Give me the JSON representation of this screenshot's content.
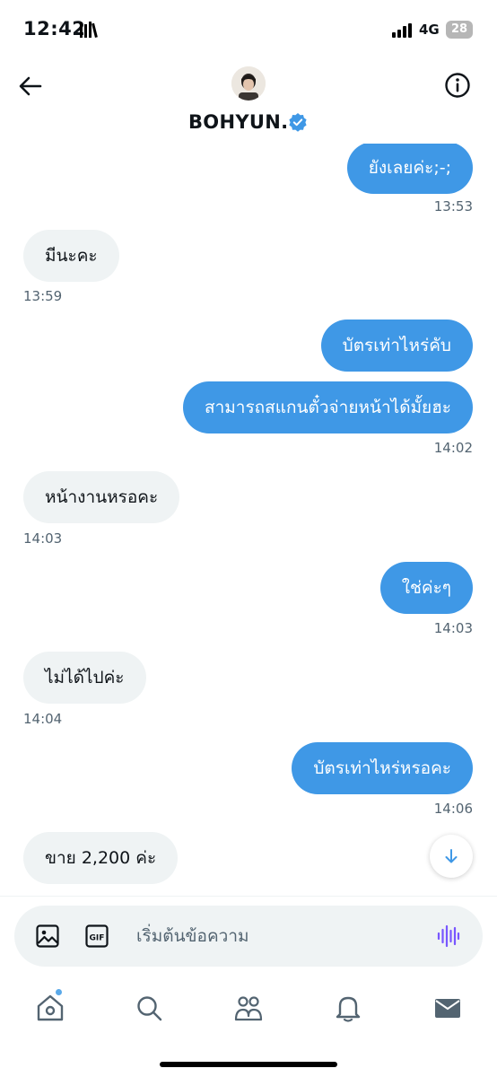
{
  "status_bar": {
    "time": "12:42",
    "network": "4G",
    "battery": "28"
  },
  "header": {
    "contact_name": "BOHYUN."
  },
  "messages": [
    {
      "direction": "out",
      "text": "ยังเลยค่ะ;-;"
    },
    {
      "direction": "out",
      "time": "13:53"
    },
    {
      "direction": "in",
      "text": "มีนะคะ"
    },
    {
      "direction": "in",
      "time": "13:59"
    },
    {
      "direction": "out",
      "text": "บัตรเท่าไหร่คับ"
    },
    {
      "direction": "out",
      "text": "สามารถสแกนตั๋วจ่ายหน้าได้มั้ยฮะ"
    },
    {
      "direction": "out",
      "time": "14:02"
    },
    {
      "direction": "in",
      "text": "หน้างานหรอคะ"
    },
    {
      "direction": "in",
      "time": "14:03"
    },
    {
      "direction": "out",
      "text": "ใช่ค่ะๆ"
    },
    {
      "direction": "out",
      "time": "14:03"
    },
    {
      "direction": "in",
      "text": "ไม่ได้ไปค่ะ"
    },
    {
      "direction": "in",
      "time": "14:04"
    },
    {
      "direction": "out",
      "text": "บัตรเท่าไหร่หรอคะ"
    },
    {
      "direction": "out",
      "time": "14:06"
    },
    {
      "direction": "in",
      "text": "ขาย 2,200 ค่ะ"
    }
  ],
  "composer": {
    "placeholder": "เริ่มต้นข้อความ"
  },
  "tabs": [
    "home-icon",
    "search-icon",
    "communities-icon",
    "notifications-icon",
    "messages-icon"
  ],
  "colors": {
    "outgoing_bubble": "#3f98e6",
    "incoming_bubble": "#eff3f4",
    "verified": "#3f98e6",
    "voice_icon": "#7856ff"
  }
}
